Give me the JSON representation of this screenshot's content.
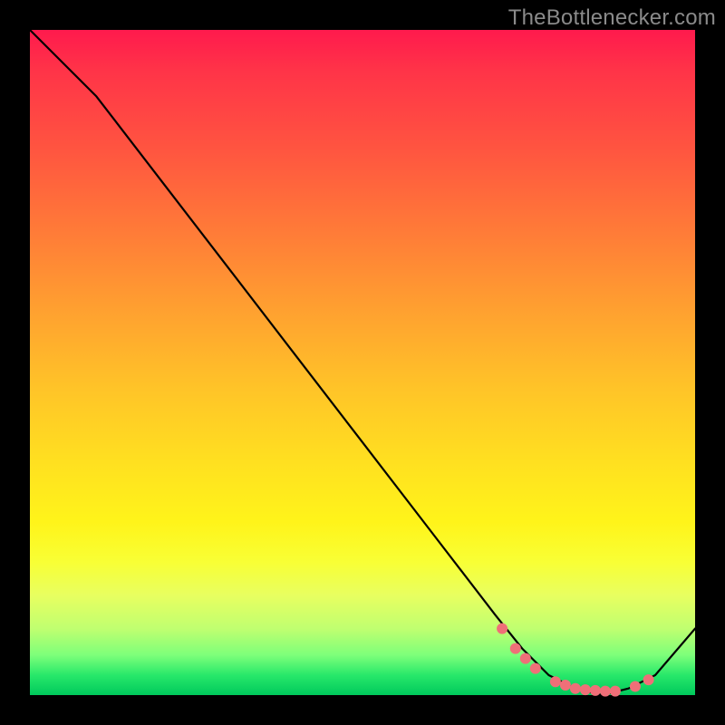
{
  "watermark": "TheBottlenecker.com",
  "chart_data": {
    "type": "line",
    "title": "",
    "xlabel": "",
    "ylabel": "",
    "xlim": [
      0,
      100
    ],
    "ylim": [
      0,
      100
    ],
    "grid": false,
    "series": [
      {
        "name": "bottleneck-curve",
        "x": [
          0,
          6,
          10,
          20,
          30,
          40,
          50,
          60,
          70,
          74,
          78,
          82,
          86,
          90,
          94,
          100
        ],
        "y": [
          100,
          94,
          90,
          77,
          64,
          51,
          38,
          25,
          12,
          7,
          3,
          1,
          0,
          1,
          3,
          10
        ]
      }
    ],
    "markers": {
      "name": "highlight-points",
      "x": [
        71,
        73,
        74.5,
        76,
        79,
        80.5,
        82,
        83.5,
        85,
        86.5,
        88,
        91,
        93
      ],
      "y": [
        10,
        7,
        5.5,
        4,
        2,
        1.5,
        1,
        0.8,
        0.7,
        0.6,
        0.6,
        1.3,
        2.3
      ]
    },
    "colors": {
      "curve": "#000000",
      "marker": "#ef6f78",
      "gradient_top": "#ff1a4d",
      "gradient_mid": "#ffe020",
      "gradient_bottom": "#00c95c"
    }
  }
}
